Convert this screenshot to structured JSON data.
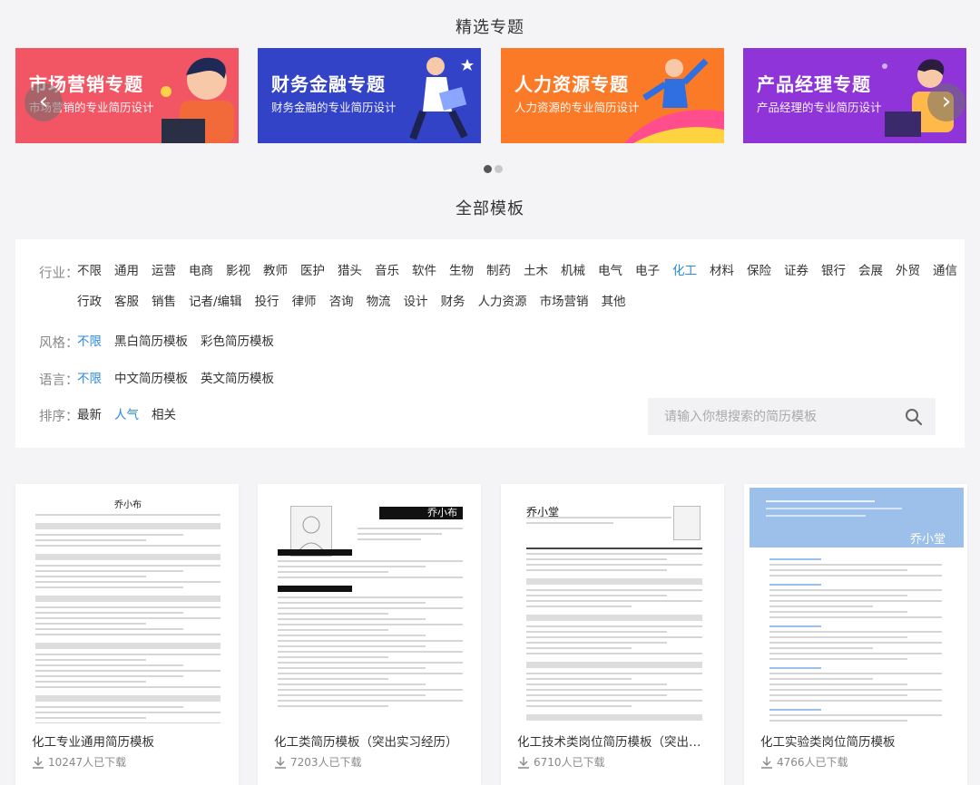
{
  "featured": {
    "title": "精选专题",
    "banners": [
      {
        "title": "市场营销专题",
        "subtitle": "市场营销的专业简历设计",
        "color": "#f25563"
      },
      {
        "title": "财务金融专题",
        "subtitle": "财务金融的专业简历设计",
        "color": "#3343c8"
      },
      {
        "title": "人力资源专题",
        "subtitle": "人力资源的专业简历设计",
        "color": "#fb7a28"
      },
      {
        "title": "产品经理专题",
        "subtitle": "产品经理的专业简历设计",
        "color": "#8e34d9"
      }
    ],
    "prev_icon": "‹",
    "next_icon": "›"
  },
  "all_templates": {
    "title": "全部模板"
  },
  "filters": {
    "industry": {
      "label": "行业：",
      "options": [
        "不限",
        "通用",
        "运营",
        "电商",
        "影视",
        "教师",
        "医护",
        "猎头",
        "音乐",
        "软件",
        "生物",
        "制药",
        "土木",
        "机械",
        "电气",
        "电子",
        "化工",
        "材料",
        "保险",
        "证券",
        "银行",
        "会展",
        "外贸",
        "通信",
        "行政",
        "客服",
        "销售",
        "记者/编辑",
        "投行",
        "律师",
        "咨询",
        "物流",
        "设计",
        "财务",
        "人力资源",
        "市场营销",
        "其他"
      ],
      "active": "化工"
    },
    "style": {
      "label": "风格：",
      "options": [
        "不限",
        "黑白简历模板",
        "彩色简历模板"
      ],
      "active": "不限"
    },
    "language": {
      "label": "语言：",
      "options": [
        "不限",
        "中文简历模板",
        "英文简历模板"
      ],
      "active": "不限"
    },
    "sort": {
      "label": "排序：",
      "options": [
        "最新",
        "人气",
        "相关"
      ],
      "active": "人气"
    },
    "search_placeholder": "请输入你想搜索的简历模板"
  },
  "cards": [
    {
      "title": "化工专业通用简历模板",
      "downloads": "10247人已下载",
      "resume_name": "乔小布"
    },
    {
      "title": "化工类简历模板（突出实习经历）",
      "downloads": "7203人已下载",
      "resume_name": "乔小布"
    },
    {
      "title": "化工技术类岗位简历模板（突出学术经历）",
      "downloads": "6710人已下载",
      "resume_name": "乔小堂"
    },
    {
      "title": "化工实验类岗位简历模板",
      "downloads": "4766人已下载",
      "resume_name": "乔小堂"
    }
  ],
  "colors": {
    "accent": "#2b89e0",
    "active_dot": "#555555"
  }
}
